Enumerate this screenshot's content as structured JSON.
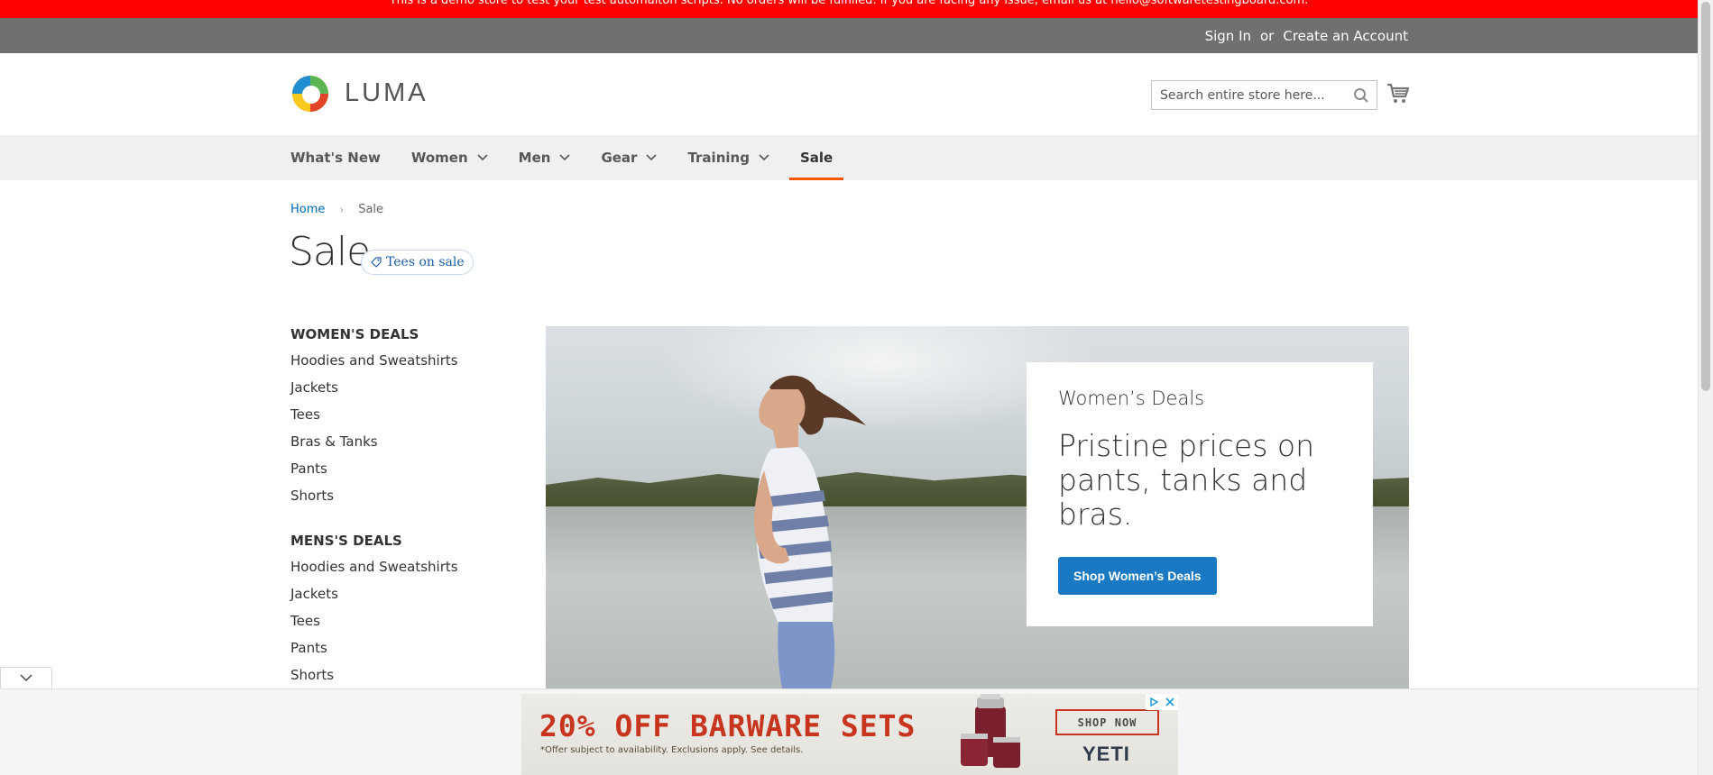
{
  "demo_banner": "This is a demo store to test your test automaiton scripts. No orders will be fulfilled. If you are facing any issue, email us at hello@softwaretestingboard.com.",
  "header": {
    "sign_in": "Sign In",
    "or": "or",
    "create_account": "Create an Account",
    "logo_text": "LUMA",
    "search_placeholder": "Search entire store here..."
  },
  "nav": {
    "items": [
      {
        "label": "What's New"
      },
      {
        "label": "Women"
      },
      {
        "label": "Men"
      },
      {
        "label": "Gear"
      },
      {
        "label": "Training"
      },
      {
        "label": "Sale"
      }
    ]
  },
  "breadcrumb": {
    "home": "Home",
    "current": "Sale"
  },
  "page": {
    "title": "Sale",
    "tag": "Tees on sale"
  },
  "sidebar": {
    "groups": [
      {
        "heading": "WOMEN'S DEALS",
        "links": [
          "Hoodies and Sweatshirts",
          "Jackets",
          "Tees",
          "Bras & Tanks",
          "Pants",
          "Shorts"
        ]
      },
      {
        "heading": "MENS'S DEALS",
        "links": [
          "Hoodies and Sweatshirts",
          "Jackets",
          "Tees",
          "Pants",
          "Shorts"
        ]
      }
    ]
  },
  "hero": {
    "eyebrow": "Women’s Deals",
    "headline": "Pristine prices on pants, tanks and bras.",
    "cta": "Shop Women’s Deals"
  },
  "ad": {
    "headline": "20% OFF BARWARE SETS",
    "fine_print": "*Offer subject to availability. Exclusions apply. See details.",
    "shop_now": "SHOP NOW",
    "brand": "YETI"
  },
  "colors": {
    "banner": "#ff0000",
    "top_bar": "#6e716e",
    "accent": "#ff5501",
    "link": "#006bb4",
    "cta": "#1979c3"
  }
}
